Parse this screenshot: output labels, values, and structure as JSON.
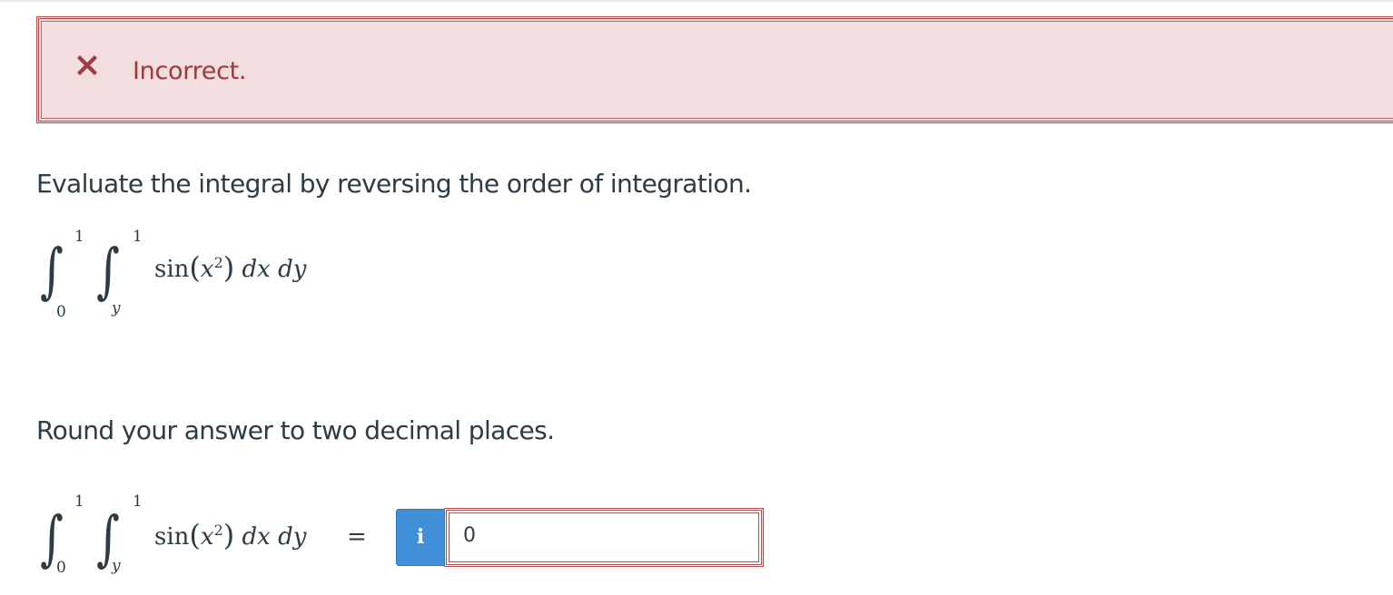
{
  "feedback": {
    "status_icon": "x-mark-icon",
    "status_color": "#a0393b",
    "status_text": "Incorrect."
  },
  "question": {
    "prompt": "Evaluate the integral by reversing the order of integration.",
    "integral": {
      "outer_upper": "1",
      "outer_lower": "0",
      "inner_upper": "1",
      "inner_lower": "y",
      "integrand_fn": "sin",
      "integrand_var": "x",
      "integrand_exp": "2",
      "differentials": "dx dy"
    },
    "instruction": "Round your answer to two decimal places."
  },
  "answer": {
    "equals": "=",
    "info_label": "i",
    "value": "0"
  }
}
